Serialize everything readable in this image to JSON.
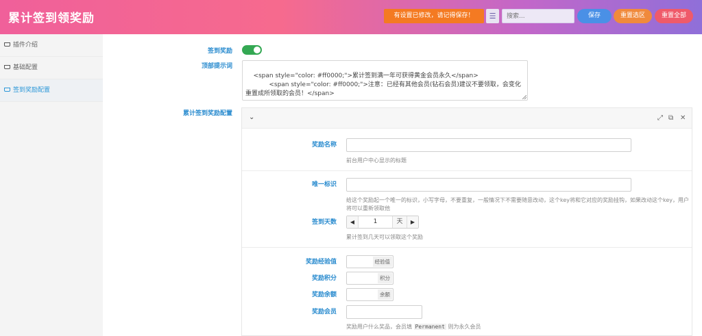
{
  "app": {
    "title": "累计签到领奖励"
  },
  "header": {
    "notice": "有设置已修改，请记得保存！",
    "search_placeholder": "搜索...",
    "save": "保存",
    "reset_section": "重置选区",
    "reset_all": "重置全部",
    "icons": {
      "list": "list-icon"
    }
  },
  "sidebar": {
    "items": [
      {
        "label": "插件介绍",
        "icon": "cup-icon",
        "active": false
      },
      {
        "label": "基础配置",
        "icon": "cup-icon",
        "active": false
      },
      {
        "label": "签到奖励配置",
        "icon": "cup-icon",
        "active": true
      }
    ]
  },
  "main": {
    "toggle_label": "签到奖励",
    "toggle_on": true,
    "top_tip_label": "顶部提示词",
    "top_tip_value": "<span style=\"color: #ff0000;\">累计签到满一年可获得黄金会员永久</span>\n            <span style=\"color: #ff0000;\">注意：已经有其他会员(钻石会员)建议不要领取，会变化重置成所领取的会员！</span>",
    "reward_config_label": "累计签到奖励配置"
  },
  "panel": {
    "fields": {
      "name_label": "奖励名称",
      "name_value": "",
      "name_help": "前台用户中心显示的标题",
      "id_label": "唯一标识",
      "id_value": "",
      "id_help": "给这个奖励起一个唯一的标识，小写字母，不要重复，一般情况下不需要随意改动，这个key将和它对应的奖励挂钩，如果改动这个key，用户将可以重新领取他",
      "days_label": "签到天数",
      "days_value": "1",
      "days_unit": "天",
      "days_help": "累计签到几天可以领取这个奖励",
      "exp_label": "奖励经验值",
      "exp_addon": "经验值",
      "points_label": "奖励积分",
      "points_addon": "积分",
      "balance_label": "奖励余额",
      "balance_addon": "余额",
      "member_label": "奖励会员",
      "member_help_pre": "奖励用户什么奖品，会员填",
      "member_help_code": "Permanent",
      "member_help_post": "则为永久会员"
    }
  }
}
